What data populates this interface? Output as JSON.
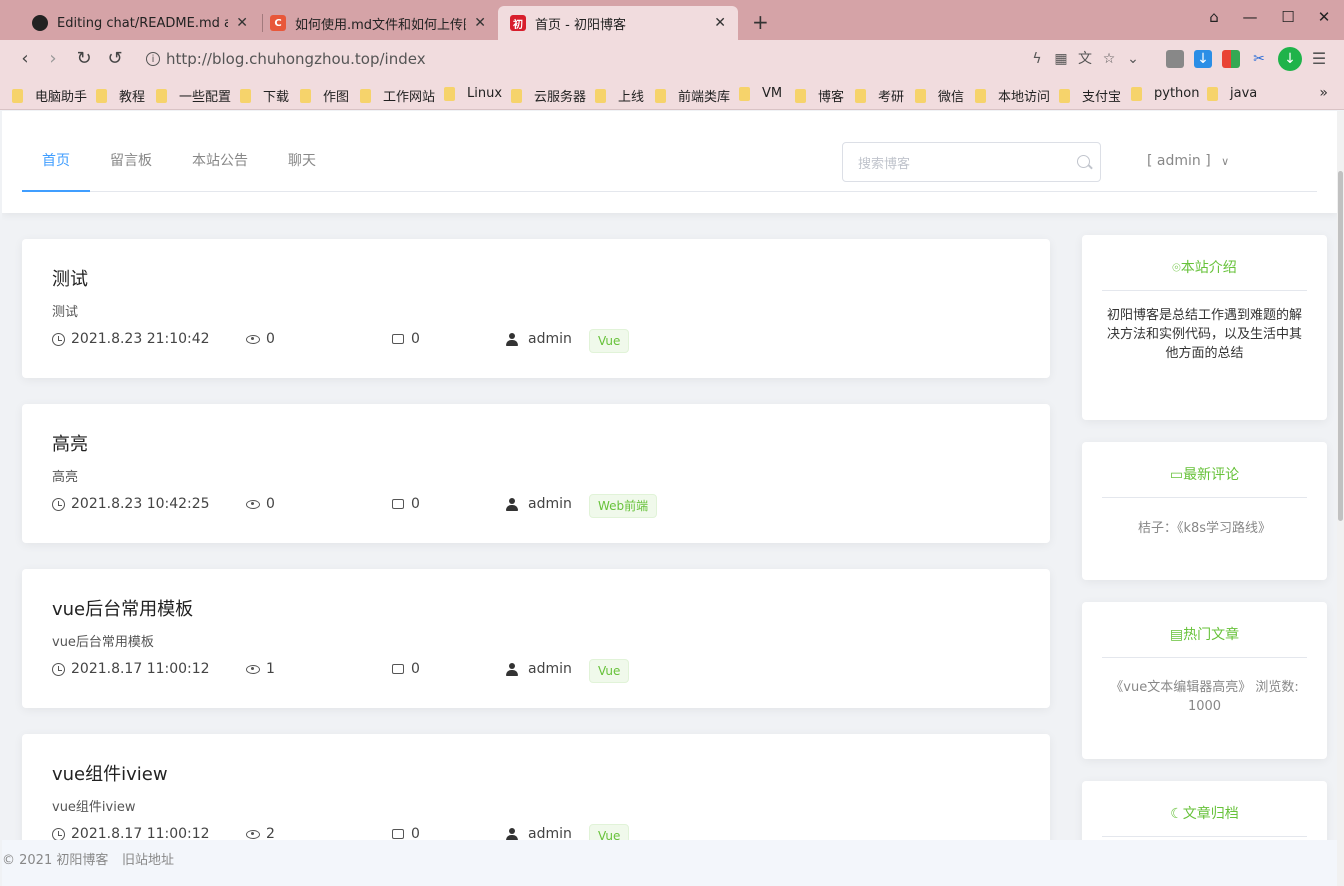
{
  "browser": {
    "tabs": [
      {
        "label": "Editing chat/README.md at m",
        "active": false
      },
      {
        "label": "如何使用.md文件和如何上传图片",
        "active": false
      },
      {
        "label": "首页 - 初阳博客",
        "active": true
      }
    ],
    "url": "http://blog.chuhongzhou.top/index",
    "bookmarks": [
      "电脑助手",
      "教程",
      "一些配置",
      "下载",
      "作图",
      "工作网站",
      "Linux",
      "云服务器",
      "上线",
      "前端类库",
      "VM",
      "博客",
      "考研",
      "微信",
      "本地访问",
      "支付宝",
      "python",
      "java"
    ]
  },
  "site": {
    "nav": [
      "首页",
      "留言板",
      "本站公告",
      "聊天"
    ],
    "search_placeholder": "搜索博客",
    "user_menu": "[  admin  ]"
  },
  "posts": [
    {
      "title": "测试",
      "desc": "测试",
      "date": "2021.8.23 21:10:42",
      "views": "0",
      "comments": "0",
      "author": "admin",
      "tag": "Vue"
    },
    {
      "title": "高亮",
      "desc": "高亮",
      "date": "2021.8.23 10:42:25",
      "views": "0",
      "comments": "0",
      "author": "admin",
      "tag": "Web前端"
    },
    {
      "title": "vue后台常用模板",
      "desc": "vue后台常用模板",
      "date": "2021.8.17 11:00:12",
      "views": "1",
      "comments": "0",
      "author": "admin",
      "tag": "Vue"
    },
    {
      "title": "vue组件iview",
      "desc": "vue组件iview",
      "date": "2021.8.17 11:00:12",
      "views": "2",
      "comments": "0",
      "author": "admin",
      "tag": "Vue"
    }
  ],
  "sidebar": {
    "intro": {
      "title": "本站介绍",
      "body": "初阳博客是总结工作遇到难题的解决方法和实例代码，以及生活中其他方面的总结"
    },
    "comments": {
      "title": "最新评论",
      "body": "桔子：《k8s学习路线》"
    },
    "hot": {
      "title": "热门文章",
      "body": "《vue文本编辑器高亮》 浏览数: 1000"
    },
    "archive": {
      "title": "文章归档"
    }
  },
  "footer": {
    "copyright": "© 2021 初阳博客",
    "old_site": "旧站地址"
  },
  "colors": {
    "accent": "#409eff",
    "green": "#67c23a",
    "chrome": "#d5a3a7",
    "toolbar": "#f1dcde"
  }
}
